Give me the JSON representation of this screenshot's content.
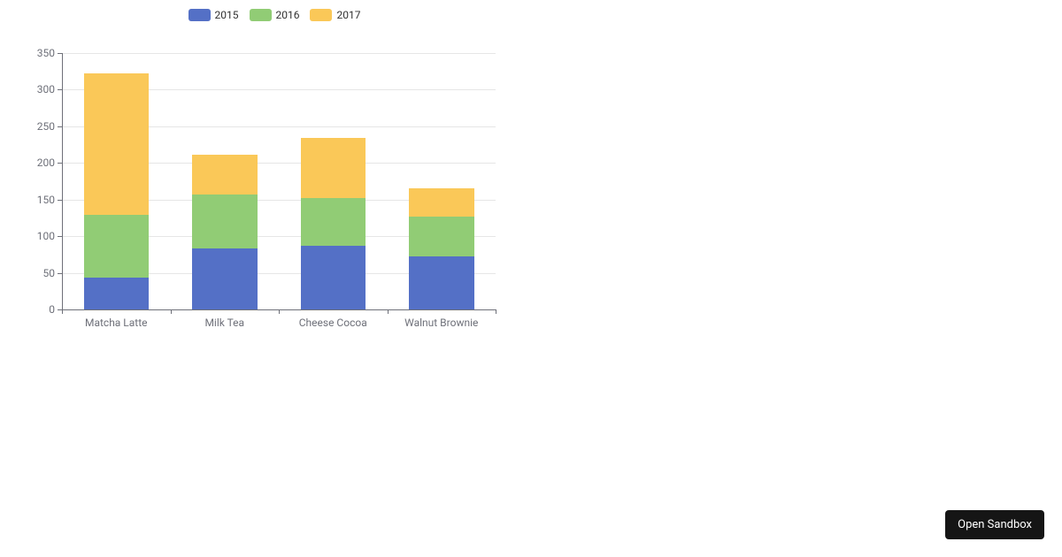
{
  "chart_data": {
    "type": "bar",
    "stacked": true,
    "categories": [
      "Matcha Latte",
      "Milk Tea",
      "Cheese Cocoa",
      "Walnut Brownie"
    ],
    "series": [
      {
        "name": "2015",
        "color": "#5470c6",
        "values": [
          43.3,
          83.1,
          86.4,
          72.4
        ]
      },
      {
        "name": "2016",
        "color": "#91cc75",
        "values": [
          85.8,
          73.4,
          65.2,
          53.9
        ]
      },
      {
        "name": "2017",
        "color": "#fac858",
        "values": [
          193.7,
          55.1,
          82.5,
          39.1
        ]
      }
    ],
    "xlabel": "",
    "ylabel": "",
    "ylim": [
      0,
      350
    ],
    "ystep": 50,
    "grid": true,
    "legend_position": "top"
  },
  "buttons": {
    "open_sandbox": "Open Sandbox"
  }
}
